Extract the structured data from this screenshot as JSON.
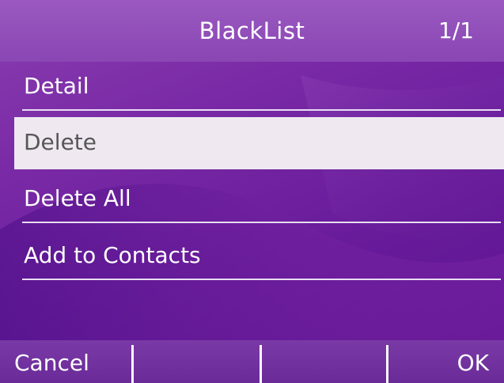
{
  "header": {
    "title": "BlackList",
    "page_indicator": "1/1"
  },
  "menu": {
    "items": [
      {
        "label": "Detail",
        "selected": false
      },
      {
        "label": "Delete",
        "selected": true
      },
      {
        "label": "Delete All",
        "selected": false
      },
      {
        "label": "Add to Contacts",
        "selected": false
      }
    ]
  },
  "softkeys": {
    "left": "Cancel",
    "middle_left": "",
    "middle_right": "",
    "right": "OK"
  },
  "colors": {
    "background": "#7a2aa6",
    "title_bar": "#9a58c0",
    "selection": "#efe8f1",
    "selected_text": "#575757",
    "text": "#ffffff"
  }
}
